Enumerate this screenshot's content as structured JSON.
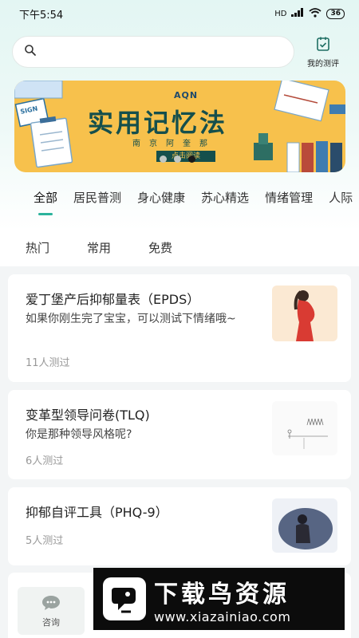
{
  "status_bar": {
    "time": "下午5:54",
    "signal": "HD",
    "battery": "36"
  },
  "search": {
    "placeholder": ""
  },
  "my_test": {
    "label": "我的测评"
  },
  "banner": {
    "brand": "AQN",
    "title": "实用记忆法",
    "subtitle": "南京阿奎那",
    "button": "点击阅读",
    "sign": "SIGN",
    "dots": 3,
    "active_dot": 2
  },
  "category_tabs": [
    "全部",
    "居民普测",
    "身心健康",
    "苏心精选",
    "情绪管理",
    "人际"
  ],
  "filter_tabs": [
    "热门",
    "常用",
    "免费"
  ],
  "cards": [
    {
      "title": "爱丁堡产后抑郁量表（EPDS）",
      "desc": "如果你刚生完了宝宝，可以测试下情绪哦~",
      "count": "11人测过"
    },
    {
      "title": "变革型领导问卷(TLQ)",
      "desc": "你是那种领导风格呢?",
      "count": "6人测过"
    },
    {
      "title": "抑郁自评工具（PHQ-9）",
      "desc": "",
      "count": "5人测过"
    }
  ],
  "bottom_nav": {
    "consult": "咨询"
  },
  "watermark": {
    "name": "下载鸟资源",
    "url": "www.xiazainiao.com"
  },
  "colors": {
    "accent": "#2bb39c",
    "banner": "#f7c14c",
    "banner_text": "#154f4c"
  }
}
